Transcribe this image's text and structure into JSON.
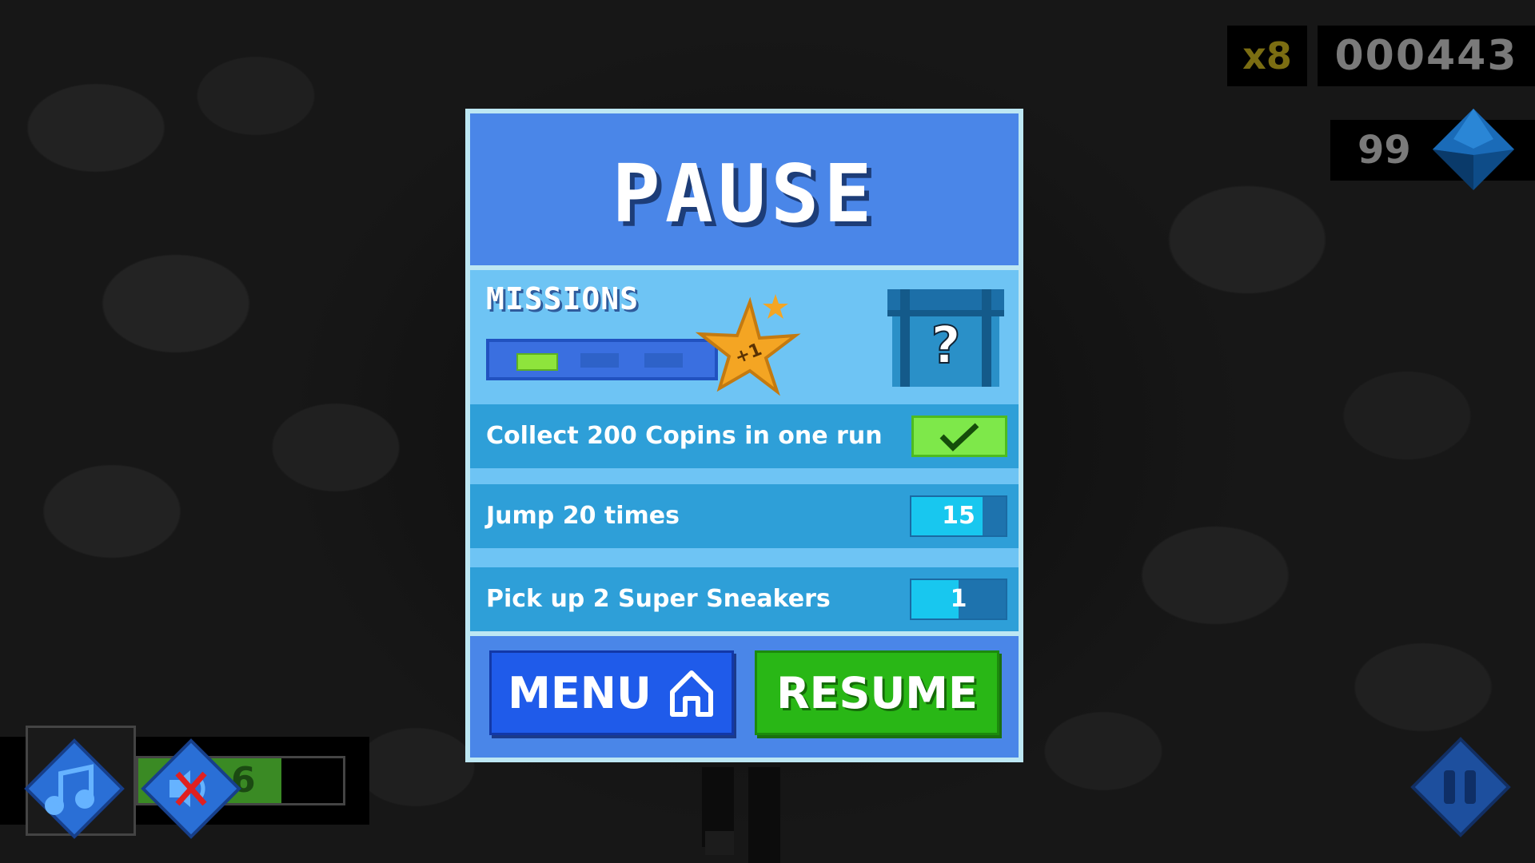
{
  "hud": {
    "multiplier": "x8",
    "score": "000443",
    "gems": "99"
  },
  "pause_panel": {
    "title": "PAUSE",
    "missions_label": "MISSIONS",
    "missions_progress": {
      "completed": 1,
      "total": 3
    },
    "star_badge": "+1",
    "chest_symbol": "?",
    "missions": [
      {
        "text": "Collect 200 Copins in one run",
        "status": "done"
      },
      {
        "text": "Jump 20 times",
        "progress": "15",
        "fraction": 0.75
      },
      {
        "text": "Pick up 2 Super Sneakers",
        "progress": "1",
        "fraction": 0.5
      }
    ],
    "menu_label": "MENU",
    "resume_label": "RESUME"
  },
  "powerup": {
    "counter": "6",
    "fraction": 0.7
  },
  "colors": {
    "panel_blue": "#4a86e8",
    "mission_row": "#2e9fd8",
    "progress_fill": "#18c7ef",
    "resume_green": "#29b716",
    "menu_blue": "#1f5bea"
  },
  "icons": [
    "gem-icon",
    "star-icon",
    "chest-icon",
    "checkmark-icon",
    "home-icon",
    "music-icon",
    "sound-off-icon",
    "pause-icon"
  ]
}
